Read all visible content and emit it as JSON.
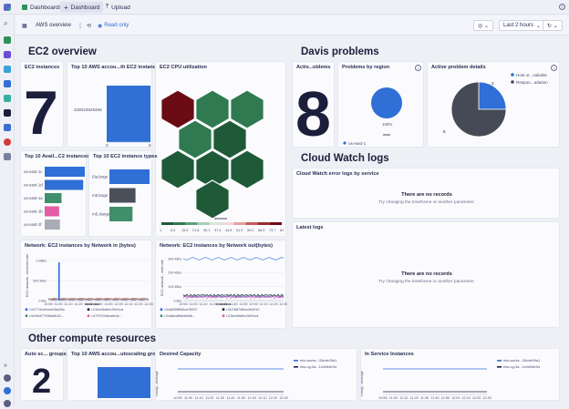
{
  "topbar": {
    "apps": "Dashboards",
    "tab_dashboard": "Dashboard",
    "tab_upload": "Upload"
  },
  "subbar": {
    "title": "AWS overview",
    "readonly": "Read only",
    "timeframe": "Last 2 hours"
  },
  "sections": {
    "ec2": "EC2 overview",
    "davis": "Davis problems",
    "cloudwatch": "Cloud Watch logs",
    "other": "Other compute resources"
  },
  "ec2_instances": {
    "title": "EC2 instances",
    "value": "7"
  },
  "top_accounts": {
    "title": "Top 10 AWS accou...th EC2 instances",
    "chart_data": {
      "type": "bar",
      "orientation": "horizontal",
      "categories": [
        "428023525488"
      ],
      "values": [
        5
      ],
      "xlim": [
        0,
        5
      ],
      "ticks": [
        "0",
        "5"
      ]
    }
  },
  "cpu_util": {
    "title": "EC2 CPU utilization",
    "legend_ticks": [
      "1",
      "6.3",
      "15.5",
      "21.8",
      "30.1",
      "37.4",
      "44.6",
      "51.9",
      "59.2",
      "66.5",
      "73.7",
      "81"
    ],
    "hex_colors": [
      "#6b0b14",
      "#2f7a50",
      "#2f7a50",
      "#2f7a50",
      "#1f5a38",
      "#1f5a38",
      "#1f5a38",
      "#1f5a38",
      "#1f5a38"
    ],
    "palette": [
      "#1f5a38",
      "#2f7a50",
      "#5f9e7a",
      "#a9cdb5",
      "#d8e6dc",
      "#f3d6d6",
      "#e5a3a3",
      "#c75a5a",
      "#9b2b2b",
      "#6b0b14"
    ]
  },
  "davis_active": {
    "title": "Activ...oblems",
    "value": "8"
  },
  "problems_region": {
    "title": "Problems by region",
    "center": "100%",
    "legend": "us-east-1",
    "chart_data": {
      "type": "pie",
      "labels": [
        "us-east-1"
      ],
      "values": [
        100
      ]
    }
  },
  "problem_details": {
    "title": "Active problem details",
    "legend": [
      "Host or...vailable",
      "Respon...adation"
    ],
    "slice_labels": [
      "2",
      "6"
    ],
    "chart_data": {
      "type": "pie",
      "labels": [
        "Host or...vailable",
        "Respon...adation"
      ],
      "values": [
        2,
        6
      ],
      "colors": [
        "#2f6fd6",
        "#454a56"
      ]
    }
  },
  "top_az": {
    "title": "Top 10 Avail...C2 instances",
    "chart_data": {
      "type": "bar",
      "orientation": "horizontal",
      "categories": [
        "us-east-1c",
        "us-east-1d",
        "us-east-1a",
        "us-east-1b",
        "us-east-1f"
      ],
      "values": [
        5,
        4.8,
        2.1,
        1.8,
        1.9
      ],
      "colors": [
        "#2f6fd6",
        "#2f6fd6",
        "#3f8f6a",
        "#e45ca3",
        "#a9abb5"
      ]
    }
  },
  "top_types": {
    "title": "Top 10 EC2 instance types",
    "chart_data": {
      "type": "bar",
      "orientation": "horizontal",
      "categories": [
        "t3a.large",
        "m5.large",
        "m5.xlarge"
      ],
      "values": [
        4,
        2.6,
        2.3
      ],
      "colors": [
        "#2f6fd6",
        "#4a4f5a",
        "#3f8f6a"
      ]
    }
  },
  "net_in": {
    "title": "Network: EC2 instances by Network in (bytes)",
    "ylabel": "EC2 network - received rate",
    "yticks": [
      "1 MB/s",
      "500 kB/s",
      "0 B/s"
    ],
    "xticks": [
      "10:50",
      "11:00",
      "11:10",
      "11:20",
      "11:30",
      "11:40",
      "11:50",
      "12:00",
      "12:10",
      "12:20",
      "12:30"
    ],
    "legend": [
      "i-0477d1e6cab18a28a",
      "i-03ee0bdfec9b91ca",
      "i-0e9bd77996a5b18...",
      "i-d7f7f7cf4ba6e3c..."
    ]
  },
  "net_out": {
    "title": "Network: EC2 instances by Network out(bytes)",
    "ylabel": "EC2 network - sent rate",
    "yticks": [
      "300 kB/s",
      "200 kB/s",
      "100 kB/s",
      "0 B/s"
    ],
    "xticks": [
      "10:50",
      "11:00",
      "11:10",
      "11:20",
      "11:30",
      "11:40",
      "11:50",
      "12:00",
      "12:10",
      "12:20",
      "12:30"
    ],
    "legend": [
      "i-0d6835ff84bd78597",
      "i-0b788748bc0b4910",
      "i-0da6ca5fab6a0b...",
      "i-03ee0bdfec9b91ca"
    ]
  },
  "cw_errors": {
    "title": "Cloud Watch error logs by service",
    "empty": "There are no records",
    "hint": "Try changing the timeframe or another parameter."
  },
  "cw_latest": {
    "title": "Latest logs",
    "empty": "There are no records",
    "hint": "Try changing the timeframe or another parameter."
  },
  "asg": {
    "title": "Auto sc... groups",
    "value": "2"
  },
  "top_asg": {
    "title": "Top 10 AWS accou...utoscaling groups"
  },
  "desired": {
    "title": "Desired Capacity",
    "ylabel": "Group...Average",
    "xticks": [
      "10:50",
      "11:00",
      "11:10",
      "11:20",
      "11:30",
      "11:40",
      "11:50",
      "12:00",
      "12:10",
      "12:20",
      "12:30"
    ],
    "legend": [
      "eks-worke...05cde09a1",
      "eks-ng-0a...1c0e54e9d"
    ]
  },
  "inservice": {
    "title": "In Service Instances",
    "ylabel": "Group...Average",
    "xticks": [
      "10:50",
      "11:00",
      "11:10",
      "11:20",
      "11:30",
      "11:40",
      "11:50",
      "12:00",
      "12:10",
      "12:20",
      "12:30"
    ],
    "legend": [
      "eks-worke...05cde09a1",
      "eks-ng-0a...1c0e54e9d"
    ]
  }
}
